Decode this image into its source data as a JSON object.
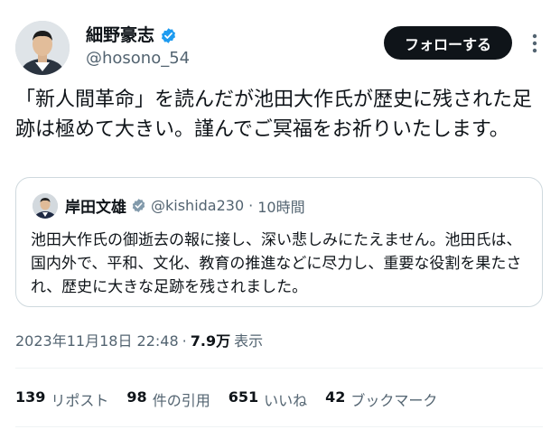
{
  "author": {
    "name": "細野豪志",
    "handle": "@hosono_54",
    "verified": true,
    "verified_color": "#1d9bf0"
  },
  "follow_button_label": "フォローする",
  "tweet_text": "「新人間革命」を読んだが池田大作氏が歴史に残された足跡は極めて大きい。謹んでご冥福をお祈りいたします。",
  "quoted_tweet": {
    "name": "岸田文雄",
    "handle": "@kishida230",
    "separator": "·",
    "time": "10時間",
    "badge": "government-gray",
    "badge_color": "#829aab",
    "text": "池田大作氏の御逝去の報に接し、深い悲しみにたえません。池田氏は、国内外で、平和、文化、教育の推進などに尽力し、重要な役割を果たされ、歴史に大きな足跡を残されました。"
  },
  "meta": {
    "datetime": "2023年11月18日 22:48",
    "separator": "·",
    "views": "7.9万",
    "views_label": "表示"
  },
  "stats": {
    "reposts": {
      "count": "139",
      "label": "リポスト"
    },
    "quotes": {
      "count": "98",
      "label": "件の引用"
    },
    "likes": {
      "count": "651",
      "label": "いいね"
    },
    "bookmarks": {
      "count": "42",
      "label": "ブックマーク"
    }
  },
  "icons": {
    "more": "more-options-icon",
    "verified": "verified-badge-icon",
    "government": "government-badge-icon"
  }
}
